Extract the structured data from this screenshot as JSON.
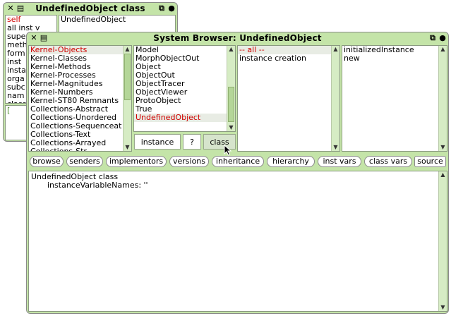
{
  "inspector": {
    "title": "UndefinedObject class",
    "fields": [
      "self",
      "all inst v",
      "supe",
      "meth",
      "form",
      "inst",
      "insta",
      "orga",
      "subc",
      "nam",
      "class"
    ],
    "value": "UndefinedObject",
    "eval_text": "["
  },
  "browser": {
    "title": "System Browser: UndefinedObject",
    "categories": [
      "Kernel-Objects",
      "Kernel-Classes",
      "Kernel-Methods",
      "Kernel-Processes",
      "Kernel-Magnitudes",
      "Kernel-Numbers",
      "Kernel-ST80 Remnants",
      "Collections-Abstract",
      "Collections-Unordered",
      "Collections-Sequenceat",
      "Collections-Text",
      "Collections-Arrayed",
      "Collections-Str"
    ],
    "classes": [
      "Model",
      "MorphObjectOut",
      "Object",
      "ObjectOut",
      "ObjectTracer",
      "ObjectViewer",
      "ProtoObject",
      "True",
      "UndefinedObject"
    ],
    "protocols": [
      "-- all --",
      "instance creation"
    ],
    "methods": [
      "initializedInstance",
      "new"
    ],
    "tabs": {
      "instance": "instance",
      "help": "?",
      "class": "class"
    },
    "buttons": {
      "browse": "browse",
      "senders": "senders",
      "implementors": "implementors",
      "versions": "versions",
      "inheritance": "inheritance",
      "hierarchy": "hierarchy",
      "inst_vars": "inst vars",
      "class_vars": "class vars",
      "source": "source"
    },
    "code_line1": "UndefinedObject class",
    "code_line2": "instanceVariableNames: ''"
  },
  "colors": {
    "window_bg": "#c4e4a8",
    "selection_text": "#d00000"
  },
  "icons": {
    "close": "close-icon",
    "menu": "window-menu-icon",
    "collapse": "collapse-icon",
    "expand": "expand-icon"
  }
}
